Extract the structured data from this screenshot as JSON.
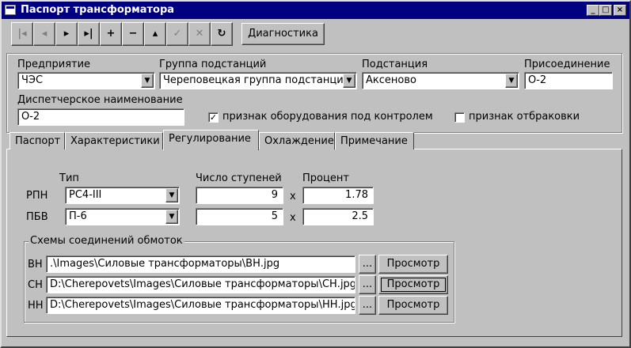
{
  "window": {
    "title": "Паспорт трансформатора"
  },
  "toolbar": {
    "buttons": [
      {
        "icon": "first-record-icon",
        "glyph": "|◂",
        "enabled": false
      },
      {
        "icon": "prev-record-icon",
        "glyph": "◂",
        "enabled": false
      },
      {
        "icon": "next-record-icon",
        "glyph": "▸",
        "enabled": true
      },
      {
        "icon": "last-record-icon",
        "glyph": "▸|",
        "enabled": true
      },
      {
        "icon": "add-record-icon",
        "glyph": "+",
        "enabled": true
      },
      {
        "icon": "delete-record-icon",
        "glyph": "−",
        "enabled": true
      },
      {
        "icon": "edit-record-icon",
        "glyph": "▴",
        "enabled": true
      },
      {
        "icon": "post-edit-icon",
        "glyph": "✓",
        "enabled": false
      },
      {
        "icon": "cancel-edit-icon",
        "glyph": "✕",
        "enabled": false
      },
      {
        "icon": "refresh-icon",
        "glyph": "↻",
        "enabled": true
      }
    ],
    "diagnostics_label": "Диагностика"
  },
  "header": {
    "enterprise": {
      "label": "Предприятие",
      "value": "ЧЭС"
    },
    "substation_group": {
      "label": "Группа подстанций",
      "value": "Череповецкая группа подстанций"
    },
    "substation": {
      "label": "Подстанция",
      "value": "Аксеново"
    },
    "connection": {
      "label": "Присоединение",
      "value": "О-2"
    },
    "dispatch_name": {
      "label": "Диспетчерское наименование",
      "value": "О-2"
    },
    "under_control": {
      "label": "признак оборудования под контролем",
      "checked": true,
      "mark": "✓"
    },
    "reject": {
      "label": "признак отбраковки",
      "checked": false,
      "mark": ""
    }
  },
  "tabs": [
    {
      "label": "Паспорт",
      "active": false
    },
    {
      "label": "Характеристики",
      "active": false
    },
    {
      "label": "Регулирование",
      "active": true
    },
    {
      "label": "Охлаждение",
      "active": false
    },
    {
      "label": "Примечание",
      "active": false
    }
  ],
  "regulation": {
    "col_type": "Тип",
    "col_steps": "Число ступеней",
    "col_percent": "Процент",
    "times": "x",
    "rows": [
      {
        "label": "РПН",
        "type": "РС4-III",
        "steps": "9",
        "percent": "1.78"
      },
      {
        "label": "ПБВ",
        "type": "П-6",
        "steps": "5",
        "percent": "2.5"
      }
    ]
  },
  "schemes": {
    "title": "Схемы соединений обмоток",
    "browse": "...",
    "view": "Просмотр",
    "rows": [
      {
        "label": "ВН",
        "path": ".\\Images\\Силовые трансформаторы\\ВН.jpg"
      },
      {
        "label": "СН",
        "path": "D:\\Cherepovets\\Images\\Силовые трансформаторы\\СН.jpg"
      },
      {
        "label": "НН",
        "path": "D:\\Cherepovets\\Images\\Силовые трансформаторы\\НН.jpg"
      }
    ]
  },
  "colors": {
    "title_bar": "#000080",
    "face": "#c0c0c0"
  }
}
